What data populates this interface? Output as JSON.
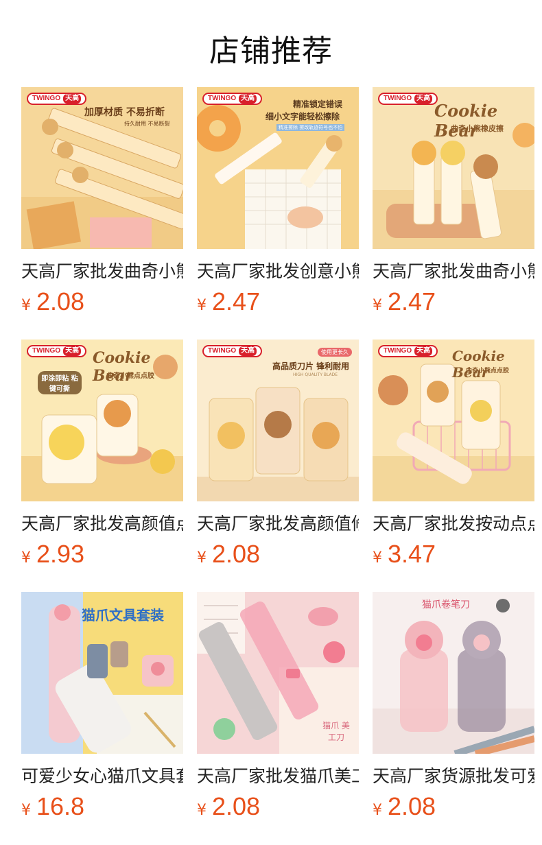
{
  "section_title": "店铺推荐",
  "brand_badge": {
    "en": "TWINGO",
    "cn": "天高"
  },
  "products": [
    {
      "name": "天高厂家批发曲奇小熊直尺",
      "price": "2.08",
      "currency": "¥",
      "image_text": [
        "加厚材质 不易折断",
        "持久耐用 不易断裂"
      ]
    },
    {
      "name": "天高厂家批发创意小熊橡皮",
      "price": "2.47",
      "currency": "¥",
      "image_text": [
        "精准锁定错误",
        "细小文字能轻松擦除",
        "精准擦除 擦改轨迹符号也不怕"
      ]
    },
    {
      "name": "天高厂家批发曲奇小熊橡皮擦",
      "price": "2.47",
      "currency": "¥",
      "image_text": [
        "Cookie Bear",
        "曲奇小熊橡皮擦"
      ]
    },
    {
      "name": "天高厂家批发高颜值点点胶",
      "price": "2.93",
      "currency": "¥",
      "image_text": [
        "Cookie Bear",
        "曲奇小熊点点胶",
        "即涂即粘 粘键可撕"
      ]
    },
    {
      "name": "天高厂家批发高颜值修正带",
      "price": "2.08",
      "currency": "¥",
      "image_text": [
        "高品质刀片 锋利耐用",
        "HIGH QUALITY BLADE",
        "使用更长久"
      ]
    },
    {
      "name": "天高厂家批发按动点点胶",
      "price": "3.47",
      "currency": "¥",
      "image_text": [
        "Cookie Bear",
        "曲奇小熊点点胶"
      ]
    },
    {
      "name": "可爱少女心猫爪文具套装",
      "price": "16.8",
      "currency": "¥",
      "image_text": [
        "猫爪文具套装"
      ]
    },
    {
      "name": "天高厂家批发猫爪美工刀",
      "price": "2.08",
      "currency": "¥",
      "image_text": [
        "猫爪 美工刀"
      ]
    },
    {
      "name": "天高厂家货源批发可爱卷笔刀",
      "price": "2.08",
      "currency": "¥",
      "image_text": [
        "猫爪卷笔刀"
      ]
    }
  ],
  "colors": {
    "price": "#e8501a",
    "brand_red": "#d8202b"
  }
}
